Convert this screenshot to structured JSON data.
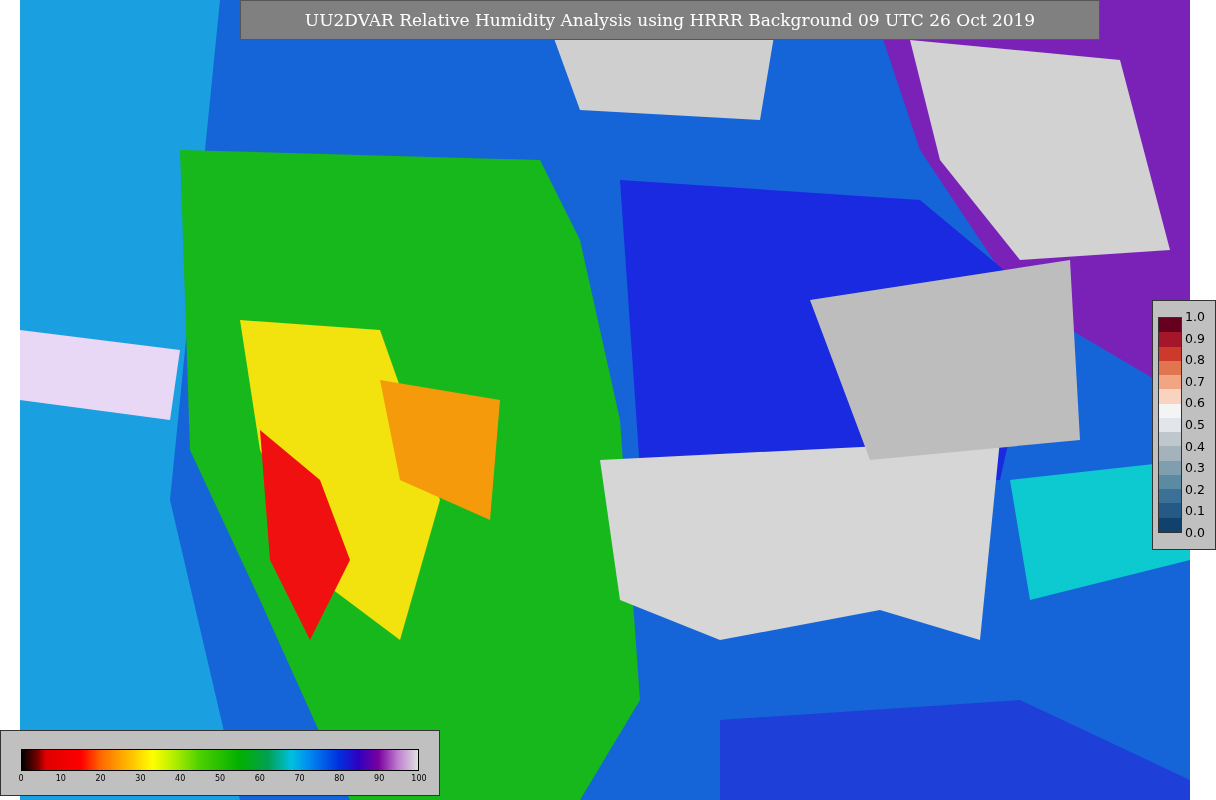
{
  "title": "UU2DVAR Relative Humidity Analysis using HRRR Background 09 UTC 26 Oct 2019",
  "humidity_scale": {
    "ticks": [
      "0",
      "10",
      "20",
      "30",
      "40",
      "50",
      "60",
      "70",
      "80",
      "90",
      "100"
    ]
  },
  "observation_scale": {
    "ticks": [
      "1.0",
      "0.9",
      "0.8",
      "0.7",
      "0.6",
      "0.5",
      "0.4",
      "0.3",
      "0.2",
      "0.1",
      "0.0"
    ]
  }
}
